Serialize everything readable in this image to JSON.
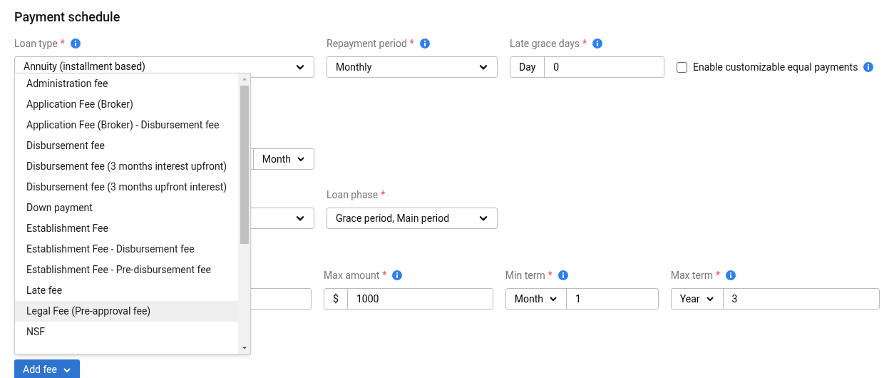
{
  "title": "Payment schedule",
  "required_mark": "*",
  "loan_type": {
    "label": "Loan type",
    "required": true,
    "info": true,
    "value": "Annuity (installment based)"
  },
  "repayment_period": {
    "label": "Repayment period",
    "required": true,
    "info": true,
    "value": "Monthly"
  },
  "late_grace_days": {
    "label": "Late grace days",
    "required": true,
    "info": true,
    "prefix": "Day",
    "value": "0"
  },
  "equal_payments": {
    "label": "Enable customizable equal payments",
    "checked": false,
    "info": true
  },
  "term_unit": {
    "value": "Month"
  },
  "loan_phase": {
    "label": "Loan phase",
    "required": true,
    "value": "Grace period, Main period"
  },
  "max_amount": {
    "label": "Max amount",
    "required": true,
    "info": true,
    "prefix": "$",
    "value": "1000"
  },
  "min_term": {
    "label": "Min term",
    "required": true,
    "info": true,
    "unit": "Month",
    "value": "1"
  },
  "max_term": {
    "label": "Max term",
    "required": true,
    "info": true,
    "unit": "Year",
    "value": "3"
  },
  "add_fee_button": "Add fee",
  "fee_menu": [
    {
      "label": "Administration fee",
      "selected": false
    },
    {
      "label": "Application Fee (Broker)",
      "selected": false
    },
    {
      "label": "Application Fee (Broker) - Disbursement fee",
      "selected": false
    },
    {
      "label": "Disbursement fee",
      "selected": false
    },
    {
      "label": "Disbursement fee (3 months interest upfront)",
      "selected": false
    },
    {
      "label": "Disbursement fee (3 months upfront interest)",
      "selected": false
    },
    {
      "label": "Down payment",
      "selected": false
    },
    {
      "label": "Establishment Fee",
      "selected": false
    },
    {
      "label": "Establishment Fee - Disbursement fee",
      "selected": false
    },
    {
      "label": "Establishment Fee - Pre-disbursement fee",
      "selected": false
    },
    {
      "label": "Late fee",
      "selected": false
    },
    {
      "label": "Legal Fee (Pre-approval fee)",
      "selected": true
    },
    {
      "label": "NSF",
      "selected": false
    }
  ]
}
